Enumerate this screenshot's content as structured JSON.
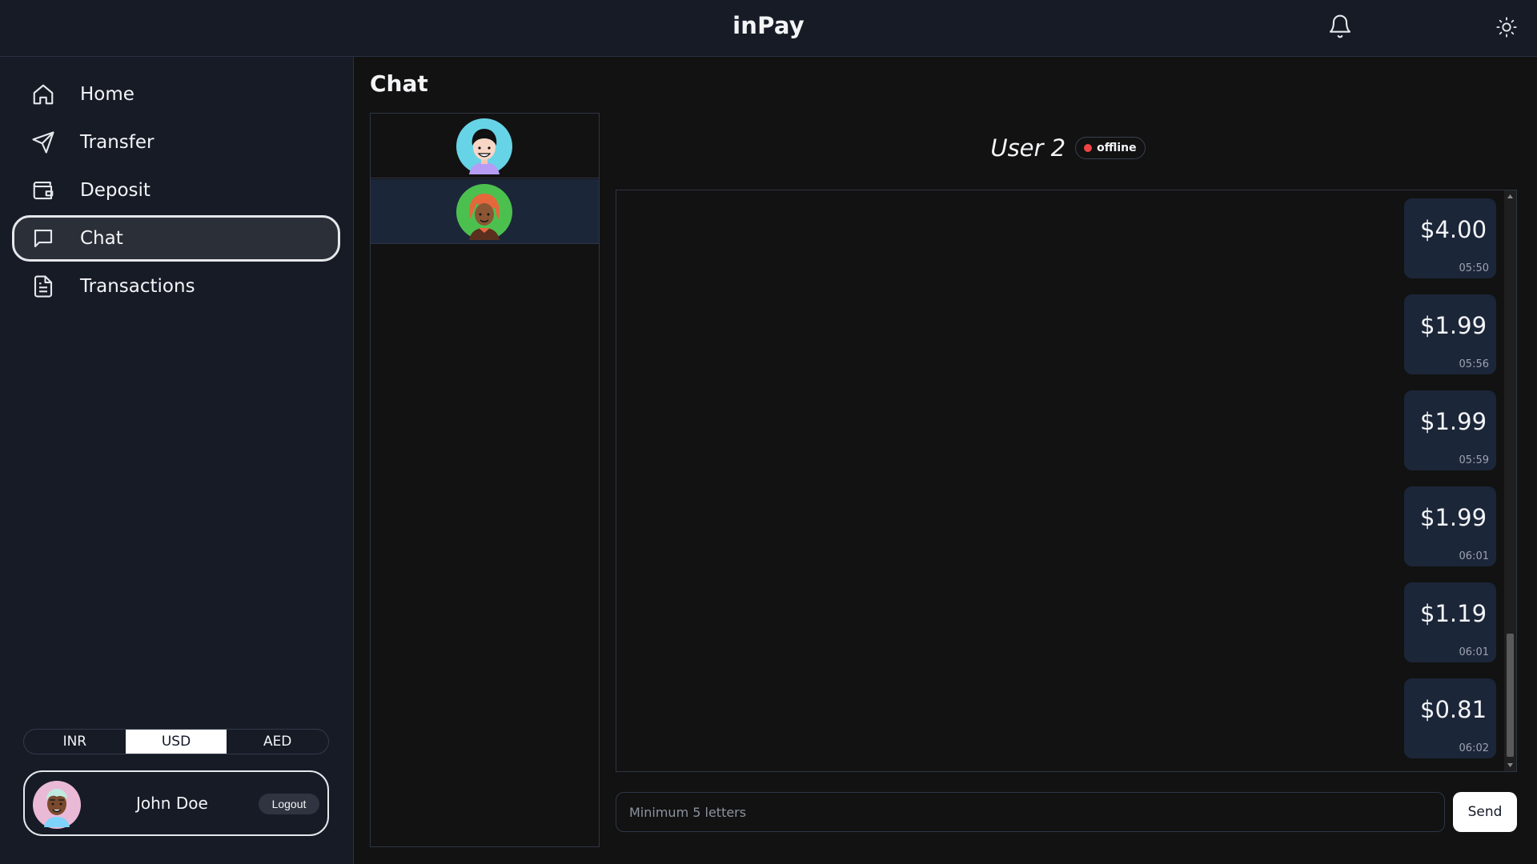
{
  "app": {
    "title": "inPay"
  },
  "header": {
    "notification_icon": "bell-icon",
    "theme_icon": "sun-icon"
  },
  "sidebar": {
    "items": [
      {
        "label": "Home",
        "icon": "home-icon",
        "active": false
      },
      {
        "label": "Transfer",
        "icon": "send-icon",
        "active": false
      },
      {
        "label": "Deposit",
        "icon": "wallet-icon",
        "active": false
      },
      {
        "label": "Chat",
        "icon": "chat-icon",
        "active": true
      },
      {
        "label": "Transactions",
        "icon": "document-icon",
        "active": false
      }
    ],
    "currencies": [
      "INR",
      "USD",
      "AED"
    ],
    "selected_currency": "USD",
    "profile": {
      "name": "John Doe",
      "logout_label": "Logout"
    }
  },
  "main": {
    "title": "Chat",
    "users": [
      {
        "avatar": "user-1-avatar",
        "selected": false
      },
      {
        "avatar": "user-2-avatar",
        "selected": true
      }
    ],
    "chat": {
      "user_name": "User 2",
      "status": "offline",
      "status_color": "#ef4444",
      "messages": [
        {
          "amount": "$4.00",
          "time": "05:50"
        },
        {
          "amount": "$1.99",
          "time": "05:56"
        },
        {
          "amount": "$1.99",
          "time": "05:59"
        },
        {
          "amount": "$1.99",
          "time": "06:01"
        },
        {
          "amount": "$1.19",
          "time": "06:01"
        },
        {
          "amount": "$0.81",
          "time": "06:02"
        }
      ],
      "input_placeholder": "Minimum 5 letters",
      "input_value": "",
      "send_label": "Send"
    }
  },
  "colors": {
    "background": "#121212",
    "panel": "#161b26",
    "bubble": "#1c2639",
    "accent": "#ffffff"
  }
}
